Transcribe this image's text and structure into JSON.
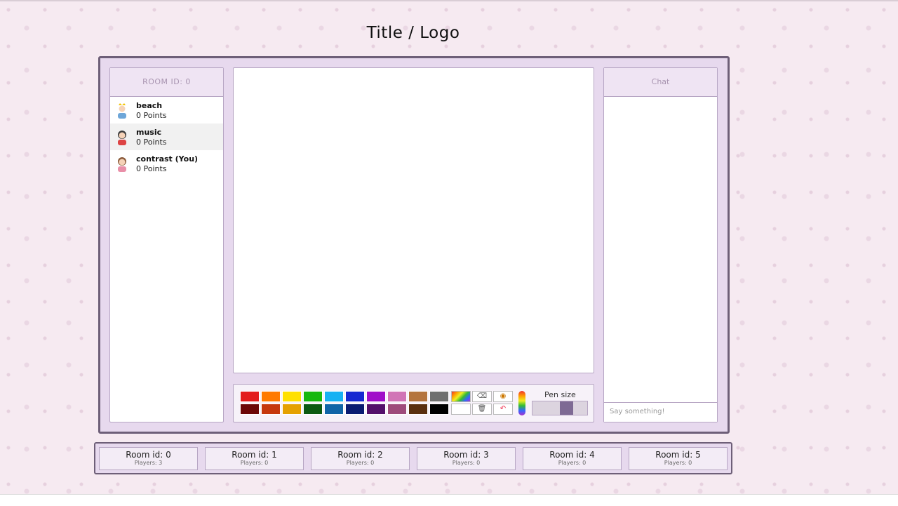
{
  "title": "Title / Logo",
  "room_panel": {
    "header": "ROOM ID: 0",
    "players": [
      {
        "name": "beach",
        "points": "0 Points",
        "avatar": "crown-avatar-icon"
      },
      {
        "name": "music",
        "points": "0 Points",
        "avatar": "girl-avatar-icon"
      },
      {
        "name": "contrast (You)",
        "points": "0 Points",
        "avatar": "girl-avatar-icon"
      }
    ]
  },
  "palette": {
    "top": [
      "#e31c1c",
      "#ff7a00",
      "#ffe000",
      "#17b80f",
      "#16b1f3",
      "#1528d1",
      "#a00ec9",
      "#d174b6",
      "#b4743e",
      "#6f6f6f"
    ],
    "bottom": [
      "#6d0707",
      "#c6380d",
      "#e5a100",
      "#0c5a12",
      "#1064a7",
      "#0a1b72",
      "#54106b",
      "#9e4b7b",
      "#5a300f",
      "#000000"
    ],
    "tools_top": [
      "rainbow",
      "eraser-icon",
      "bucket-icon"
    ],
    "tools_bottom": [
      "white",
      "trash-icon",
      "undo-icon"
    ]
  },
  "pen": {
    "label": "Pen size",
    "selected_level": 3,
    "levels": 4
  },
  "chat": {
    "header": "Chat",
    "placeholder": "Say something!"
  },
  "rooms": [
    {
      "label": "Room id: 0",
      "players": "Players: 3"
    },
    {
      "label": "Room id: 1",
      "players": "Players: 0"
    },
    {
      "label": "Room id: 2",
      "players": "Players: 0"
    },
    {
      "label": "Room id: 3",
      "players": "Players: 0"
    },
    {
      "label": "Room id: 4",
      "players": "Players: 0"
    },
    {
      "label": "Room id: 5",
      "players": "Players: 0"
    }
  ],
  "colors": {
    "frame": "#6e5f78",
    "accent": "#7e6a94"
  }
}
